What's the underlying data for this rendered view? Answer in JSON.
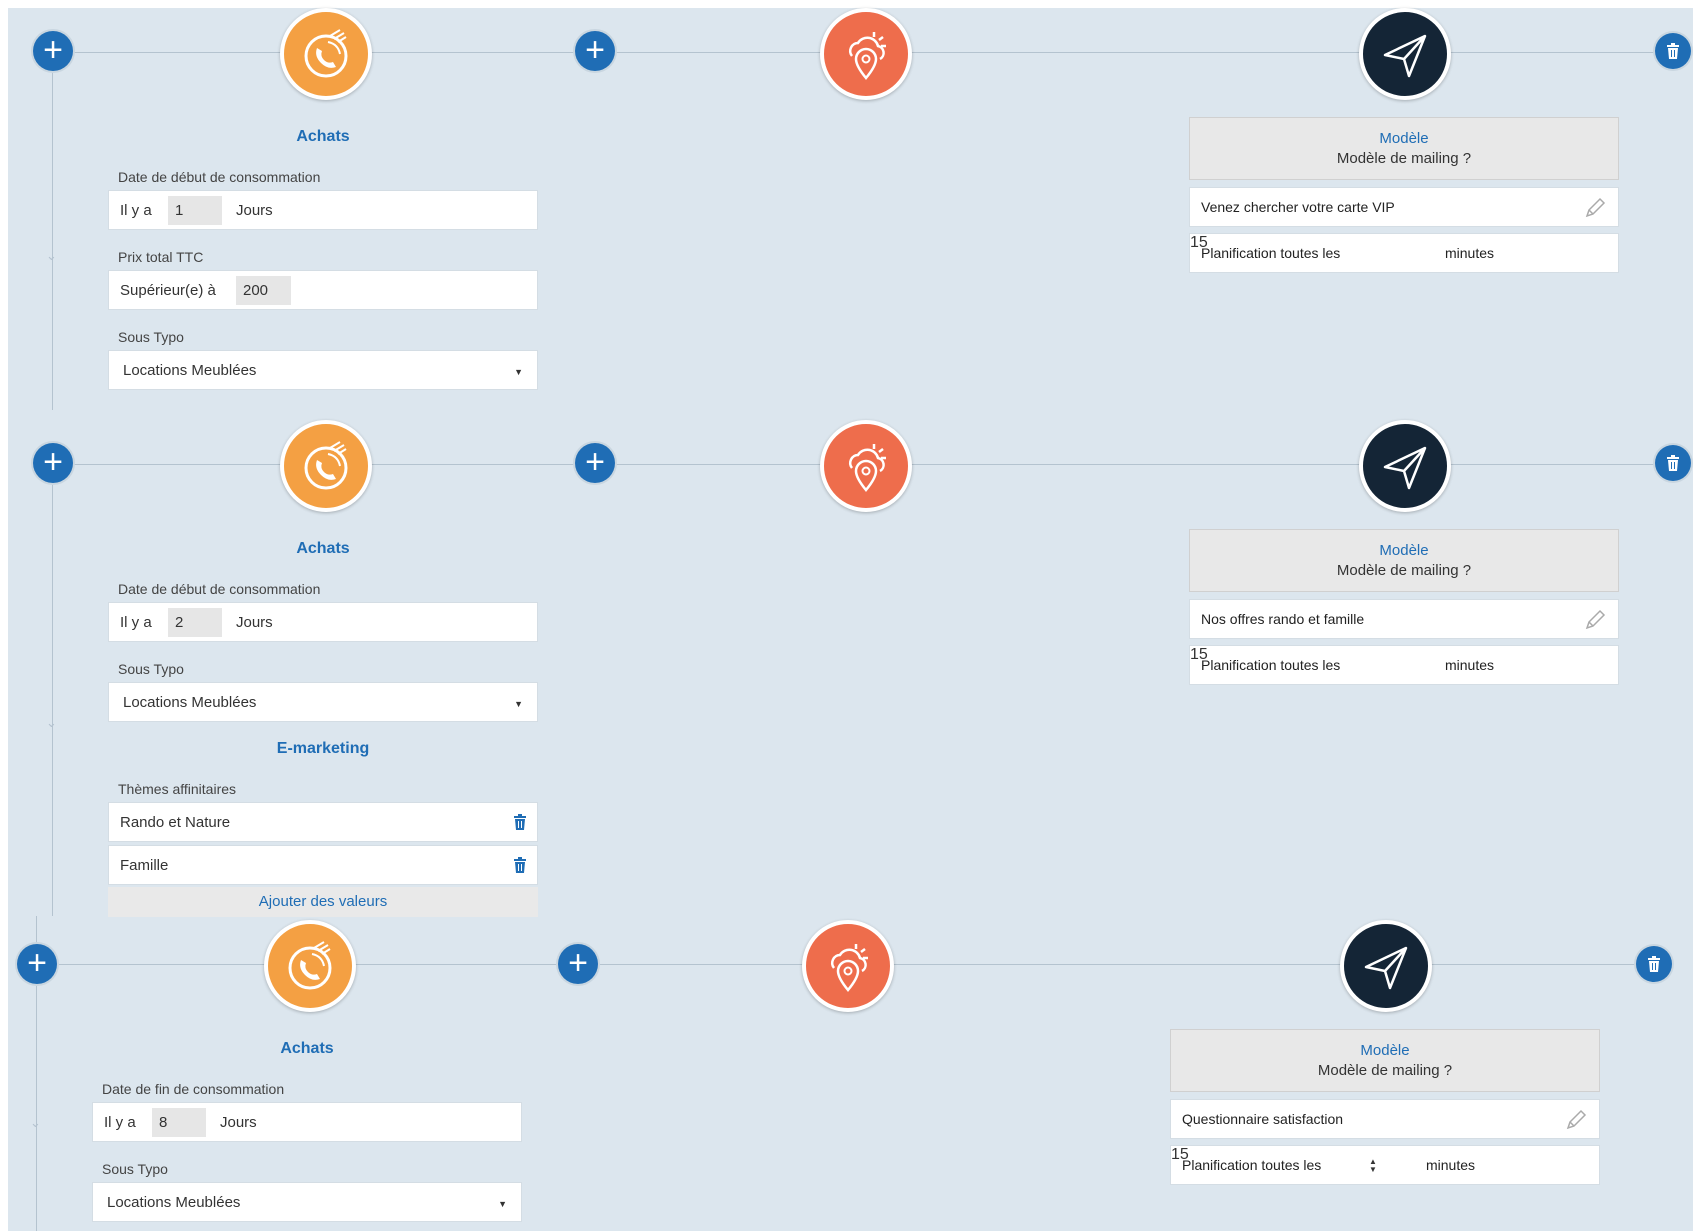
{
  "colors": {
    "panel_bg": "#dce6ee",
    "accent_blue": "#1f6db5",
    "purchases_node": "#f4a043",
    "location_node": "#ee6d4c",
    "send_node": "#142536"
  },
  "icons": {
    "add": "plus-icon",
    "delete": "trash-icon",
    "purchases": "phone-purchase-icon",
    "location": "weather-location-icon",
    "send": "paper-plane-icon",
    "edit": "pencil-icon",
    "dropdown": "caret-down-icon",
    "spinner": "up-down-icon"
  },
  "rows": [
    {
      "achats": {
        "title": "Achats",
        "date_label": "Date de début de consommation",
        "il_y_a": "Il y a",
        "days_value": "1",
        "days_unit": "Jours",
        "prix_label": "Prix total TTC",
        "prix_prefix": "Supérieur(e) à",
        "prix_value": "200",
        "sous_type_label": "Sous Typo",
        "sous_type_value": "Locations Meublées"
      },
      "modele": {
        "title": "Modèle",
        "subtitle": "Modèle de mailing ?",
        "value": "Venez chercher votre carte VIP",
        "planif_label": "Planification toutes les",
        "planif_value": "15",
        "planif_unit": "minutes"
      }
    },
    {
      "achats": {
        "title": "Achats",
        "date_label": "Date de début de consommation",
        "il_y_a": "Il y a",
        "days_value": "2",
        "days_unit": "Jours",
        "sous_type_label": "Sous Typo",
        "sous_type_value": "Locations Meublées"
      },
      "emarketing": {
        "title": "E-marketing",
        "themes_label": "Thèmes affinitaires",
        "items": [
          "Rando et Nature",
          "Famille"
        ],
        "add_label": "Ajouter des valeurs"
      },
      "modele": {
        "title": "Modèle",
        "subtitle": "Modèle de mailing ?",
        "value": "Nos offres rando et famille",
        "planif_label": "Planification toutes les",
        "planif_value": "15",
        "planif_unit": "minutes"
      }
    },
    {
      "achats": {
        "title": "Achats",
        "date_label": "Date de fin de consommation",
        "il_y_a": "Il y a",
        "days_value": "8",
        "days_unit": "Jours",
        "sous_type_label": "Sous Typo",
        "sous_type_value": "Locations Meublées"
      },
      "modele": {
        "title": "Modèle",
        "subtitle": "Modèle de mailing ?",
        "value": "Questionnaire satisfaction",
        "planif_label": "Planification toutes les",
        "planif_value": "15",
        "planif_unit": "minutes"
      }
    }
  ]
}
